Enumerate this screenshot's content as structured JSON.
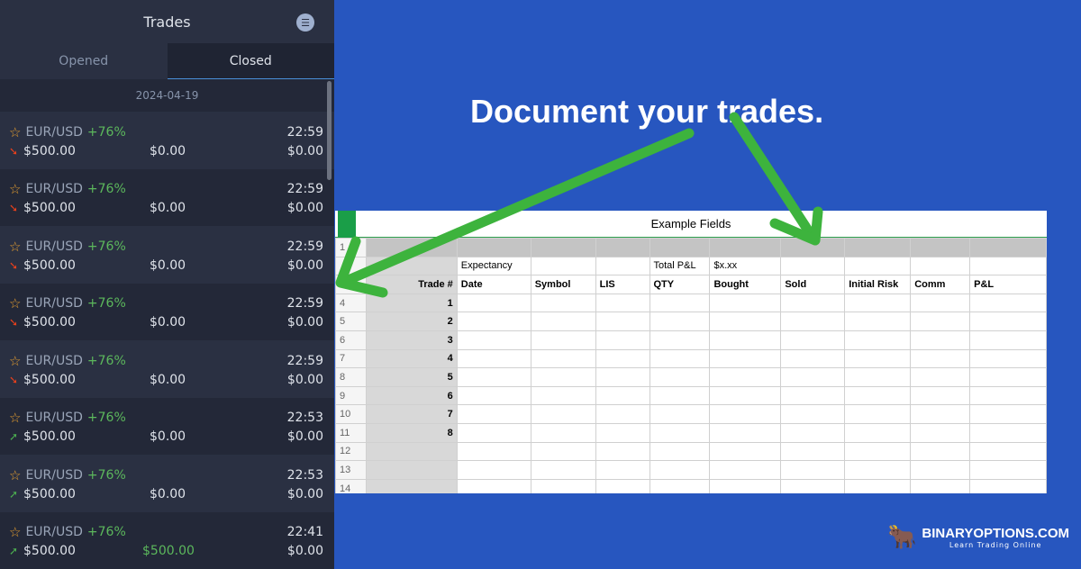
{
  "panel": {
    "title": "Trades",
    "menu_icon": "list-icon",
    "tabs": [
      "Opened",
      "Closed"
    ],
    "active_tab": "Closed",
    "date": "2024-04-19",
    "trades": [
      {
        "symbol": "EUR/USD",
        "payout": "+76%",
        "time": "22:59",
        "amount": "$500.00",
        "profit": "$0.00",
        "result": "$0.00",
        "direction": "down"
      },
      {
        "symbol": "EUR/USD",
        "payout": "+76%",
        "time": "22:59",
        "amount": "$500.00",
        "profit": "$0.00",
        "result": "$0.00",
        "direction": "down"
      },
      {
        "symbol": "EUR/USD",
        "payout": "+76%",
        "time": "22:59",
        "amount": "$500.00",
        "profit": "$0.00",
        "result": "$0.00",
        "direction": "down"
      },
      {
        "symbol": "EUR/USD",
        "payout": "+76%",
        "time": "22:59",
        "amount": "$500.00",
        "profit": "$0.00",
        "result": "$0.00",
        "direction": "down"
      },
      {
        "symbol": "EUR/USD",
        "payout": "+76%",
        "time": "22:59",
        "amount": "$500.00",
        "profit": "$0.00",
        "result": "$0.00",
        "direction": "down"
      },
      {
        "symbol": "EUR/USD",
        "payout": "+76%",
        "time": "22:53",
        "amount": "$500.00",
        "profit": "$0.00",
        "result": "$0.00",
        "direction": "up"
      },
      {
        "symbol": "EUR/USD",
        "payout": "+76%",
        "time": "22:53",
        "amount": "$500.00",
        "profit": "$0.00",
        "result": "$0.00",
        "direction": "up"
      },
      {
        "symbol": "EUR/USD",
        "payout": "+76%",
        "time": "22:41",
        "amount": "$500.00",
        "profit": "$500.00",
        "result": "$0.00",
        "direction": "up"
      }
    ]
  },
  "headline": "Document your trades.",
  "sheet": {
    "title": "Example Fields",
    "expectancy": "Expectancy",
    "total_pl": "Total P&L",
    "total_pl_value": "$x.xx",
    "headers": [
      "Trade #",
      "Date",
      "Symbol",
      "LIS",
      "QTY",
      "Bought",
      "Sold",
      "Initial Risk",
      "Comm",
      "P&L"
    ],
    "row_numbers": [
      "1",
      "",
      "",
      "4",
      "5",
      "6",
      "7",
      "8",
      "9",
      "10",
      "11",
      "12",
      "13",
      "14"
    ],
    "trade_numbers": [
      "1",
      "2",
      "3",
      "4",
      "5",
      "6",
      "7",
      "8"
    ]
  },
  "logo": {
    "name": "BINARYOPTIONS.COM",
    "tagline": "Learn Trading Online"
  },
  "colors": {
    "background": "#2756bf",
    "arrow": "#3db33d",
    "up": "#4caf50",
    "down": "#e8401c"
  }
}
